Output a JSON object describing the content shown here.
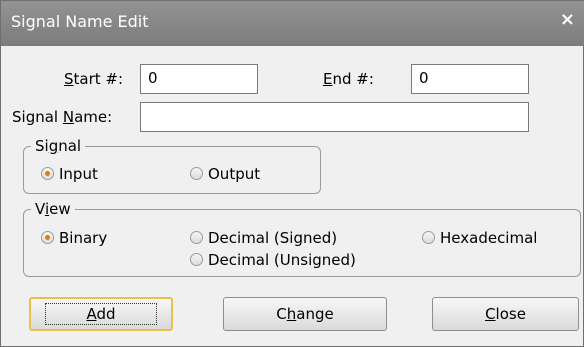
{
  "window": {
    "title": "Signal Name Edit",
    "close_glyph": "×"
  },
  "fields": {
    "start_label": "Start #:",
    "start_value": "0",
    "end_label": "End #:",
    "end_value": "0",
    "name_label": "Signal Name:",
    "name_value": ""
  },
  "signal_group": {
    "legend": "Signal",
    "options": [
      {
        "label": "Input",
        "checked": true
      },
      {
        "label": "Output",
        "checked": false
      }
    ]
  },
  "view_group": {
    "legend": "View",
    "options": [
      {
        "label": "Binary",
        "checked": true
      },
      {
        "label": "Decimal (Signed)",
        "checked": false
      },
      {
        "label": "Hexadecimal",
        "checked": false
      },
      {
        "label": "Decimal (Unsigned)",
        "checked": false
      }
    ]
  },
  "buttons": {
    "add": "Add",
    "change": "Change",
    "close": "Close"
  },
  "colors": {
    "titlebar": "#888888",
    "accent": "#e07b10",
    "default_border": "#e8c050"
  }
}
